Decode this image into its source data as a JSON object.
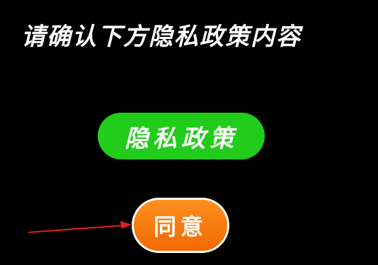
{
  "prompt": {
    "text": "请确认下方隐私政策内容"
  },
  "buttons": {
    "policy_label": "隐私政策",
    "agree_label": "同意"
  },
  "annotation": {
    "icon": "red-arrow-icon",
    "color": "#e02020"
  },
  "colors": {
    "background": "#000000",
    "policy_button": "#22cc1a",
    "agree_button": "#ff7a0a",
    "text": "#ffffff"
  }
}
